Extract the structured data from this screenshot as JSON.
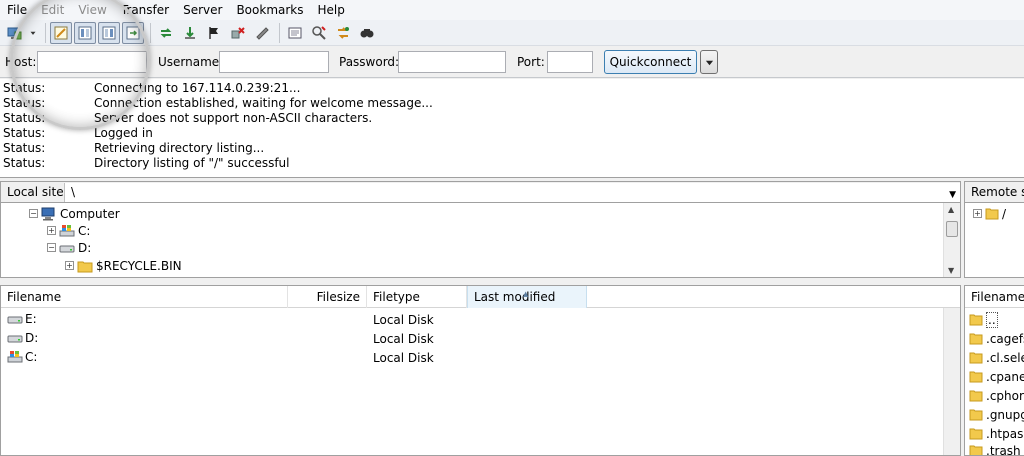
{
  "menu": {
    "items": [
      "File",
      "Edit",
      "View",
      "Transfer",
      "Server",
      "Bookmarks",
      "Help"
    ]
  },
  "toolbar": {
    "buttons": [
      "site-manager-icon",
      "dropdown-arrow-icon",
      "toggle-message-log-icon",
      "toggle-local-tree-icon",
      "toggle-remote-tree-icon",
      "toggle-transfer-queue-icon",
      "refresh-icon",
      "process-queue-icon",
      "cancel-operation-icon",
      "disconnect-icon",
      "reconnect-icon",
      "directory-filter-icon",
      "sync-browsing-icon",
      "directory-comparison-icon",
      "search-files-icon"
    ]
  },
  "quickconnect": {
    "host_label": "Host:",
    "host_value": "",
    "username_label": "Username:",
    "username_value": "",
    "password_label": "Password:",
    "password_value": "",
    "port_label": "Port:",
    "port_value": "",
    "button_label": "Quickconnect"
  },
  "log": [
    {
      "type": "Status:",
      "message": "Connecting to 167.114.0.239:21..."
    },
    {
      "type": "Status:",
      "message": "Connection established, waiting for welcome message..."
    },
    {
      "type": "Status:",
      "message": "Server does not support non-ASCII characters."
    },
    {
      "type": "Status:",
      "message": "Logged in"
    },
    {
      "type": "Status:",
      "message": "Retrieving directory listing..."
    },
    {
      "type": "Status:",
      "message": "Directory listing of \"/\" successful"
    }
  ],
  "local_site": {
    "label": "Local site:",
    "path": "\\",
    "tree": [
      {
        "label": "Computer",
        "icon": "computer-icon",
        "level": 0,
        "expander": "−"
      },
      {
        "label": "C:",
        "icon": "windows-drive-icon",
        "level": 1,
        "expander": "+"
      },
      {
        "label": "D:",
        "icon": "drive-icon",
        "level": 1,
        "expander": "−"
      },
      {
        "label": "$RECYCLE.BIN",
        "icon": "folder-icon",
        "level": 2,
        "expander": "+"
      }
    ],
    "columns": [
      "Filename",
      "Filesize",
      "Filetype",
      "Last modified"
    ],
    "files": [
      {
        "name": "E:",
        "type": "Local Disk",
        "icon": "drive-icon"
      },
      {
        "name": "D:",
        "type": "Local Disk",
        "icon": "drive-icon"
      },
      {
        "name": "C:",
        "type": "Local Disk",
        "icon": "windows-drive-icon"
      }
    ]
  },
  "remote_site": {
    "label": "Remote si",
    "tree_root": "/",
    "column": "Filename",
    "files": [
      "..",
      ".cagefs",
      ".cl.sele",
      ".cpane",
      ".cphor",
      ".gnupg",
      ".htpass",
      ".trash"
    ]
  }
}
